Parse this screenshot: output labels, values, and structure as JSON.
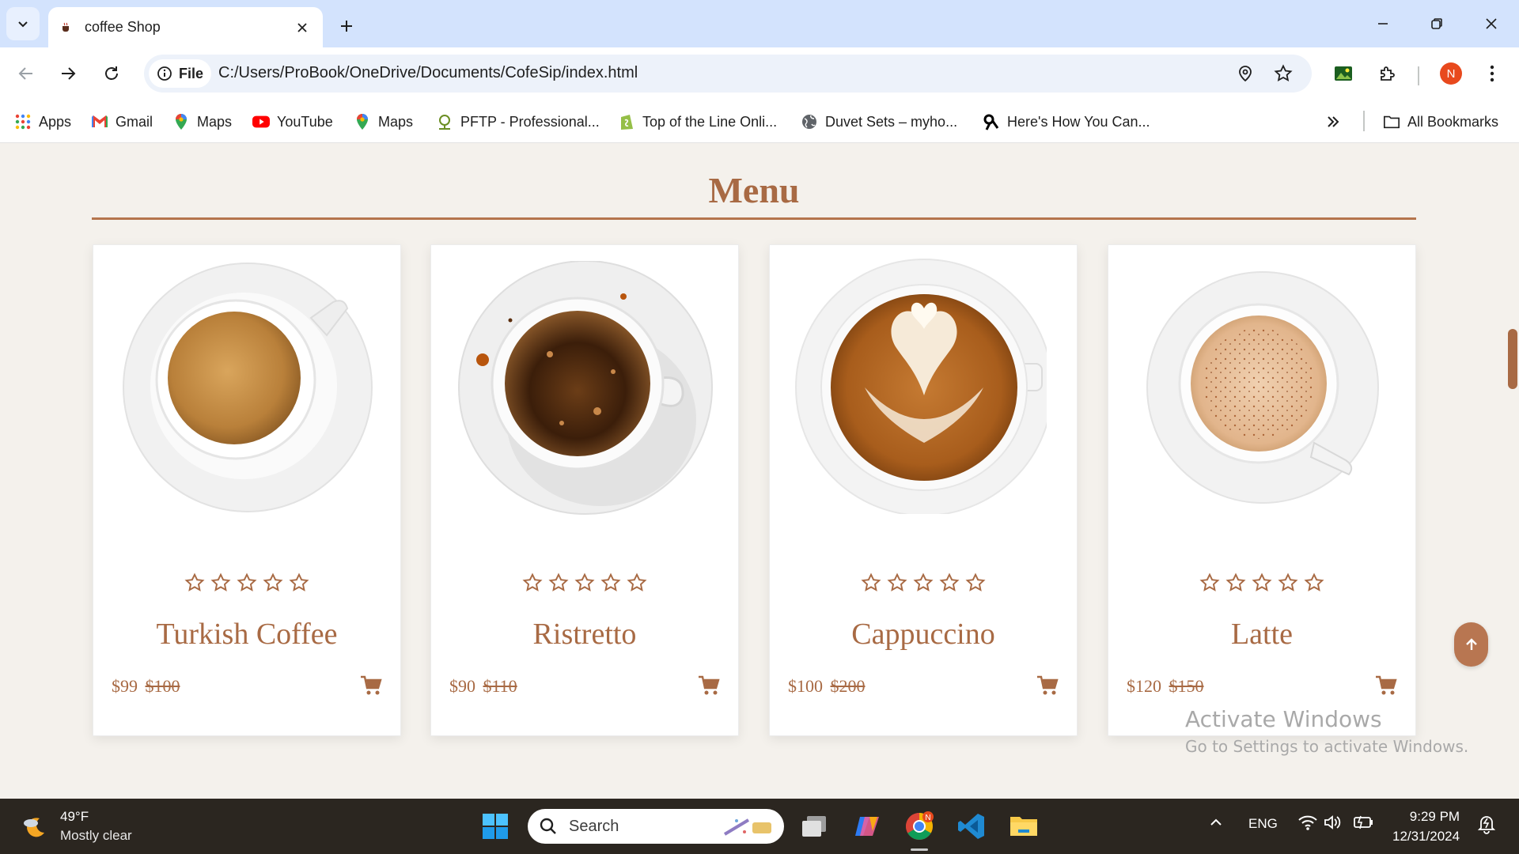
{
  "browser": {
    "tab_title": "coffee Shop",
    "omnibox_chip": "File",
    "url": "C:/Users/ProBook/OneDrive/Documents/CofeSip/index.html",
    "profile_initial": "N"
  },
  "bookmarks": [
    {
      "label": "Apps",
      "icon": "apps-grid-icon"
    },
    {
      "label": "Gmail",
      "icon": "gmail-icon"
    },
    {
      "label": "Maps",
      "icon": "maps-pin-icon"
    },
    {
      "label": "YouTube",
      "icon": "youtube-icon"
    },
    {
      "label": "Maps",
      "icon": "maps-pin-icon"
    },
    {
      "label": "PFTP - Professional...",
      "icon": "pftp-icon"
    },
    {
      "label": "Top of the Line Onli...",
      "icon": "shopify-icon"
    },
    {
      "label": "Duvet Sets – myho...",
      "icon": "globe-icon"
    },
    {
      "label": "Here's How You Can...",
      "icon": "threads-icon"
    }
  ],
  "all_bookmarks_label": "All Bookmarks",
  "page": {
    "section_title": "Menu",
    "products": [
      {
        "name": "Turkish Coffee",
        "price": "$99",
        "old_price": "$100",
        "rating": 0,
        "image": "turkish-coffee-cup"
      },
      {
        "name": "Ristretto",
        "price": "$90",
        "old_price": "$110",
        "rating": 0,
        "image": "ristretto-cup"
      },
      {
        "name": "Cappuccino",
        "price": "$100",
        "old_price": "$200",
        "rating": 0,
        "image": "cappuccino-latte-art-cup"
      },
      {
        "name": "Latte",
        "price": "$120",
        "old_price": "$150",
        "rating": 0,
        "image": "latte-cup"
      }
    ]
  },
  "watermark": {
    "line1": "Activate Windows",
    "line2": "Go to Settings to activate Windows."
  },
  "taskbar": {
    "temperature": "49°F",
    "condition": "Mostly clear",
    "search_placeholder": "Search",
    "language": "ENG",
    "time": "9:29 PM",
    "date": "12/31/2024",
    "chrome_badge": "N"
  },
  "colors": {
    "accent": "#a86a44",
    "page_background": "#f4f1ec",
    "tabbar": "#d3e3fd",
    "taskbar": "#2b2620"
  }
}
